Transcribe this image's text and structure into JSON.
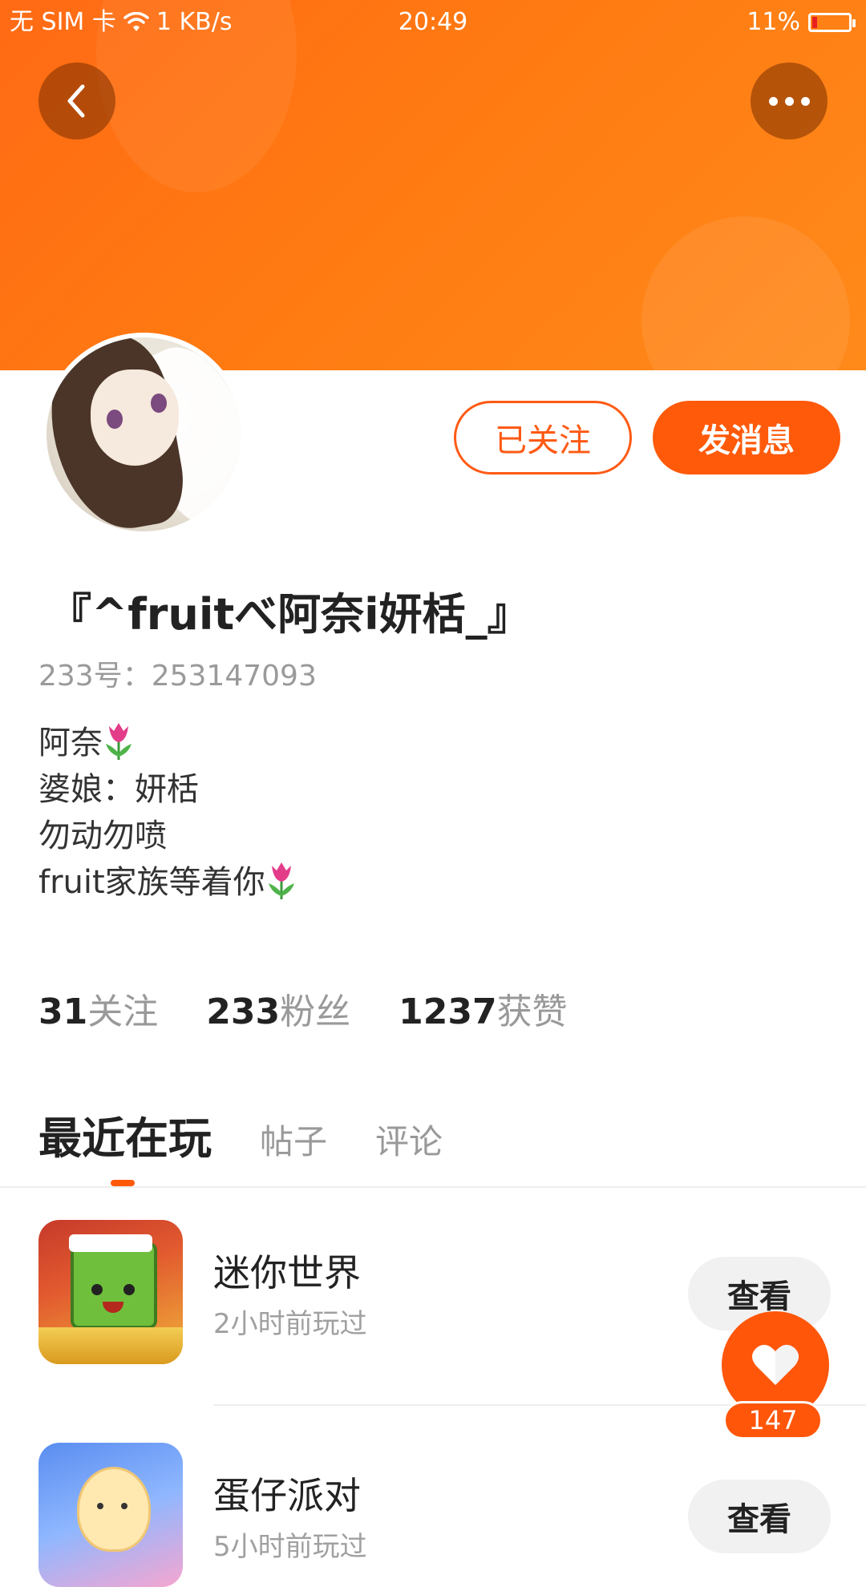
{
  "status_bar": {
    "carrier": "无 SIM 卡",
    "network_speed": "1 KB/s",
    "time": "20:49",
    "battery": "11%"
  },
  "header": {
    "back_icon": "chevron-left-icon",
    "more_icon": "more-horizontal-icon"
  },
  "profile": {
    "username": "『^fruitべ阿奈i妍栝_』",
    "user_id": "233号：253147093",
    "bio": [
      "阿奈",
      "婆娘：妍栝",
      "勿动勿喷",
      "fruit家族等着你"
    ],
    "follow_button": "已关注",
    "message_button": "发消息"
  },
  "stats": [
    {
      "num": "31",
      "label": "关注"
    },
    {
      "num": "233",
      "label": "粉丝"
    },
    {
      "num": "1237",
      "label": "获赞"
    }
  ],
  "tabs": [
    {
      "label": "最近在玩",
      "active": true
    },
    {
      "label": "帖子",
      "active": false
    },
    {
      "label": "评论",
      "active": false
    }
  ],
  "games": [
    {
      "name": "迷你世界",
      "played": "2小时前玩过",
      "button": "查看"
    },
    {
      "name": "蛋仔派对",
      "played": "5小时前玩过",
      "button": "查看"
    }
  ],
  "like": {
    "count": "147",
    "icon": "heart-icon"
  },
  "colors": {
    "accent": "#ff5a0a",
    "banner": "#ff7a12"
  }
}
